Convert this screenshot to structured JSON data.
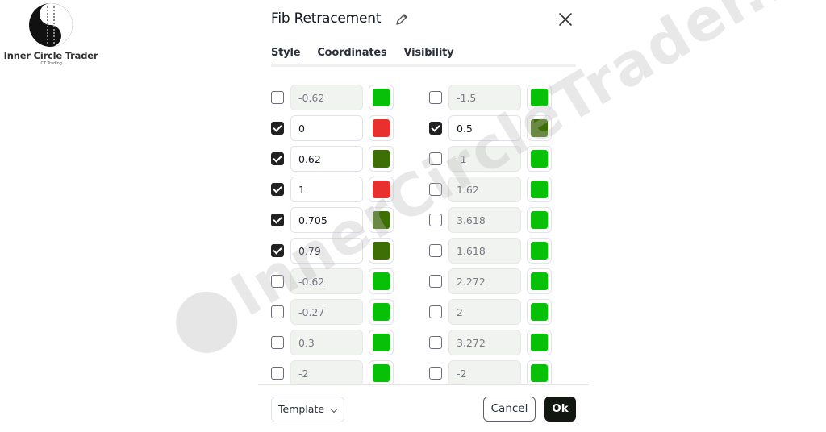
{
  "brand": {
    "name": "Inner Circle Trader",
    "subtitle": "ICT Trading"
  },
  "watermark": {
    "text": "InnerCircleTrader.net"
  },
  "dialog": {
    "title": "Fib Retracement",
    "icons": {
      "edit": "pencil-icon",
      "close": "close-icon"
    },
    "tabs": [
      {
        "label": "Style",
        "active": true
      },
      {
        "label": "Coordinates",
        "active": false
      },
      {
        "label": "Visibility",
        "active": false
      }
    ],
    "colors": {
      "bright_green": "#08c008",
      "dark_green": "#3e6e06",
      "red": "#e8302f"
    },
    "levels_left": [
      {
        "value": "-0.62",
        "checked": false,
        "color": "#08c008"
      },
      {
        "value": "0",
        "checked": true,
        "color": "#e8302f"
      },
      {
        "value": "0.62",
        "checked": true,
        "color": "#3e6e06"
      },
      {
        "value": "1",
        "checked": true,
        "color": "#e8302f"
      },
      {
        "value": "0.705",
        "checked": true,
        "color": "#3e6e06"
      },
      {
        "value": "0.79",
        "checked": true,
        "color": "#3e6e06"
      },
      {
        "value": "-0.62",
        "checked": false,
        "color": "#08c008"
      },
      {
        "value": "-0.27",
        "checked": false,
        "color": "#08c008"
      },
      {
        "value": "0.3",
        "checked": false,
        "color": "#08c008"
      },
      {
        "value": "-2",
        "checked": false,
        "color": "#08c008"
      }
    ],
    "levels_right": [
      {
        "value": "-1.5",
        "checked": false,
        "color": "#08c008"
      },
      {
        "value": "0.5",
        "checked": true,
        "color": "#3e6e06"
      },
      {
        "value": "-1",
        "checked": false,
        "color": "#08c008"
      },
      {
        "value": "1.62",
        "checked": false,
        "color": "#08c008"
      },
      {
        "value": "3.618",
        "checked": false,
        "color": "#08c008"
      },
      {
        "value": "1.618",
        "checked": false,
        "color": "#08c008"
      },
      {
        "value": "2.272",
        "checked": false,
        "color": "#08c008"
      },
      {
        "value": "2",
        "checked": false,
        "color": "#08c008"
      },
      {
        "value": "3.272",
        "checked": false,
        "color": "#08c008"
      },
      {
        "value": "-2",
        "checked": false,
        "color": "#08c008"
      }
    ],
    "footer": {
      "template_label": "Template",
      "cancel_label": "Cancel",
      "ok_label": "Ok"
    }
  }
}
